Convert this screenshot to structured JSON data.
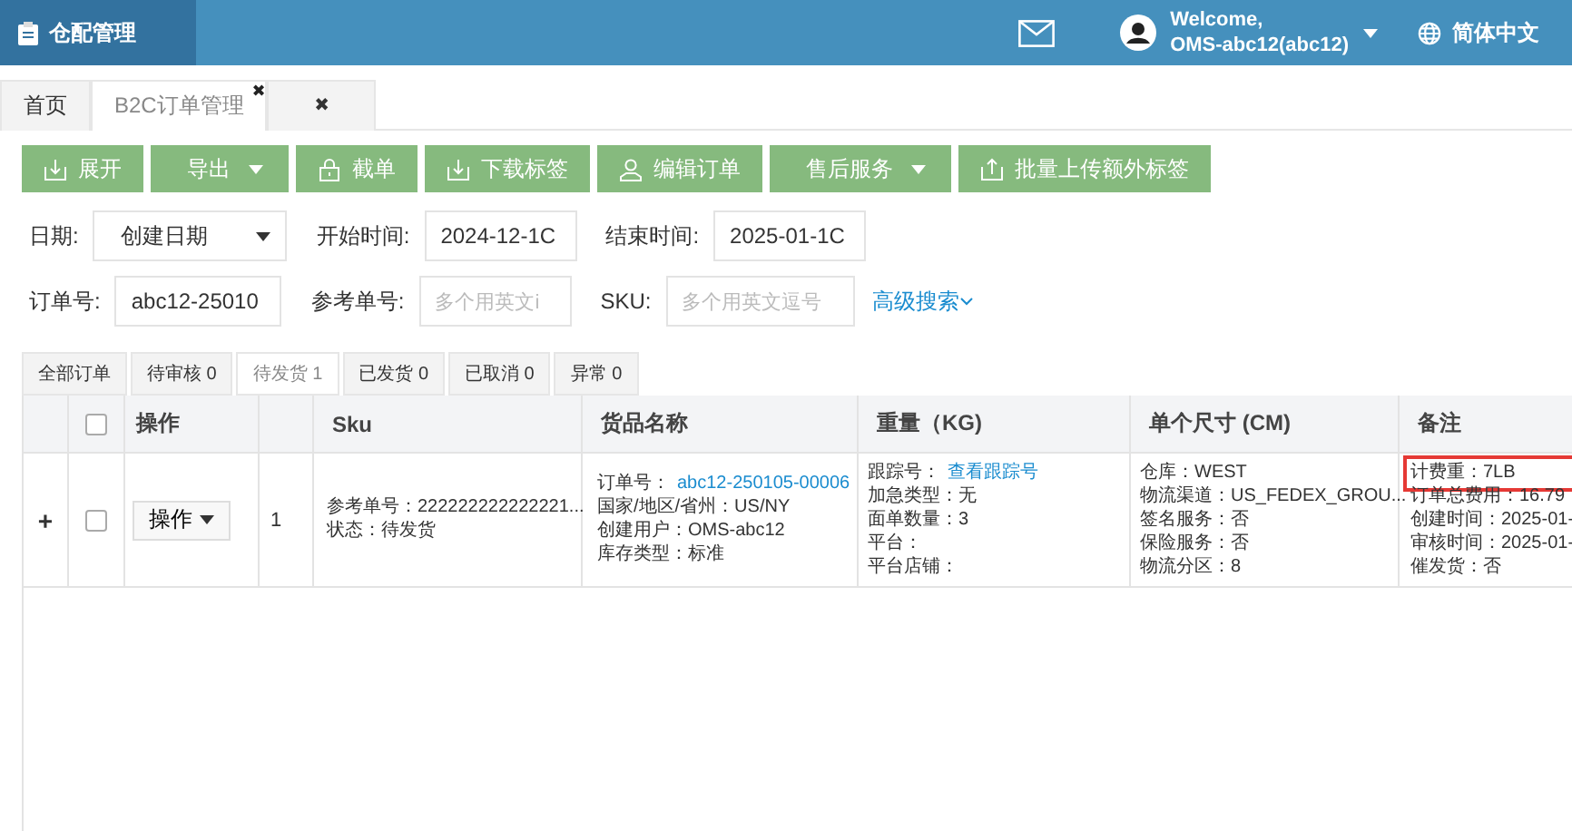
{
  "header": {
    "app_title": "仓配管理",
    "welcome": "Welcome,",
    "user": "OMS-abc12(abc12)",
    "language": "简体中文"
  },
  "page_tabs": [
    {
      "label": "首页",
      "selected": false
    },
    {
      "label": "B2C订单管理",
      "selected": true,
      "close": "✖"
    },
    {
      "label": "✖",
      "selected": false
    }
  ],
  "toolbar": [
    {
      "label": "展开",
      "kind": "download"
    },
    {
      "label": "导出",
      "kind": "dropdown"
    },
    {
      "label": "截单",
      "kind": "lock"
    },
    {
      "label": "下载标签",
      "kind": "download"
    },
    {
      "label": "编辑订单",
      "kind": "user"
    },
    {
      "label": "售后服务",
      "kind": "dropdown"
    },
    {
      "label": "批量上传额外标签",
      "kind": "upload"
    }
  ],
  "filters": [
    [
      {
        "label": "日期:",
        "kind": "select",
        "value": "创建日期"
      },
      {
        "label": "开始时间:",
        "kind": "text",
        "value": "2024-12-1C"
      },
      {
        "label": "结束时间:",
        "kind": "text",
        "value": "2025-01-1C"
      }
    ],
    [
      {
        "label": "订单号:",
        "kind": "text",
        "value": "abc12-25010"
      },
      {
        "label": "参考单号:",
        "kind": "text",
        "placeholder": "多个用英文i"
      },
      {
        "label": "SKU:",
        "kind": "text",
        "placeholder": "多个用英文逗号"
      }
    ]
  ],
  "advanced_search": "高级搜索",
  "status_tabs": [
    {
      "label": "全部订单",
      "selected": false
    },
    {
      "label": "待审核 0",
      "selected": false
    },
    {
      "label": "待发货 1",
      "selected": true
    },
    {
      "label": "已发货 0",
      "selected": false
    },
    {
      "label": "已取消 0",
      "selected": false
    },
    {
      "label": "异常 0",
      "selected": false
    }
  ],
  "table": {
    "header_checked": false,
    "columns": [
      "操作",
      "Sku",
      "货品名称",
      "重量（KG)",
      "单个尺寸 (CM)",
      "备注"
    ],
    "rows": [
      {
        "expand": "+",
        "checked": false,
        "action": "操作",
        "index": "1",
        "sku": [
          {
            "text": "参考单号：222222222222221..."
          },
          {
            "text": "状态：待发货"
          }
        ],
        "product": [
          {
            "text": "订单号：",
            "link": "abc12-250105-00006"
          },
          {
            "text": "国家/地区/省州：US/NY"
          },
          {
            "text": "创建用户：OMS-abc12"
          },
          {
            "text": "库存类型：标准"
          }
        ],
        "weight": [
          {
            "text": "跟踪号：",
            "link": "查看跟踪号"
          },
          {
            "text": "加急类型：无"
          },
          {
            "text": "面单数量：3"
          },
          {
            "text": "平台："
          },
          {
            "text": "平台店铺："
          }
        ],
        "size": [
          {
            "text": "仓库：WEST"
          },
          {
            "text": "物流渠道：US_FEDEX_GROU..."
          },
          {
            "text": "签名服务：否"
          },
          {
            "text": "保险服务：否"
          },
          {
            "text": "物流分区：8"
          }
        ],
        "remark": [
          {
            "text": "计费重：7LB",
            "highlighted": true
          },
          {
            "text": "订单总费用：16.79",
            "highlighted": false
          },
          {
            "text": "创建时间：2025-01-",
            "highlighted": false
          },
          {
            "text": "审核时间：2025-01-",
            "highlighted": false
          },
          {
            "text": "催发货：否",
            "highlighted": false
          }
        ]
      }
    ]
  }
}
